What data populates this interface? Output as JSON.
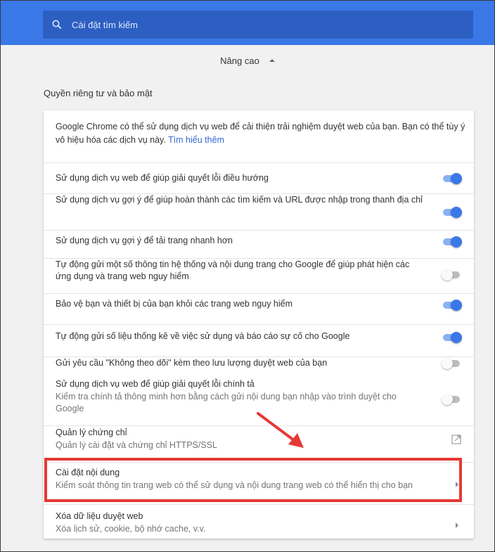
{
  "header": {
    "search_placeholder": "Cài đặt tìm kiếm",
    "accent_color": "#3b78e7"
  },
  "advanced": {
    "label": "Nâng cao"
  },
  "section": {
    "title": "Quyền riêng tư và bảo mật"
  },
  "intro": {
    "text": "Google Chrome có thể sử dụng dịch vụ web để cải thiện trải nghiệm duyệt web của bạn. Bạn có thể tùy ý vô hiệu hóa các dịch vụ này.",
    "link": "Tìm hiểu thêm"
  },
  "settings": [
    {
      "label": "Sử dụng dịch vụ web để giúp giải quyết lỗi điều hướng",
      "enabled": true
    },
    {
      "label": "Sử dụng dịch vụ gợi ý để giúp hoàn thành các tìm kiếm và URL được nhập trong thanh địa chỉ",
      "enabled": true
    },
    {
      "label": "Sử dụng dịch vụ gợi ý để tải trang nhanh hơn",
      "enabled": true
    },
    {
      "label": "Tự động gửi một số thông tin hệ thống và nội dung trang cho Google để giúp phát hiện các ứng dụng và trang web nguy hiểm",
      "enabled": false
    },
    {
      "label": "Bảo vệ bạn và thiết bị của bạn khỏi các trang web nguy hiểm",
      "enabled": true
    },
    {
      "label": "Tự động gửi số liệu thống kê về việc sử dụng và báo cáo sự cố cho Google",
      "enabled": true
    },
    {
      "label": "Gửi yêu cầu \"Không theo dõi\" kèm theo lưu lượng duyệt web của bạn",
      "enabled": false
    },
    {
      "label": "Sử dụng dịch vụ web để giúp giải quyết lỗi chính tả",
      "sub": "Kiểm tra chính tả thông minh hơn bằng cách gửi nội dung bạn nhập vào trình duyệt cho Google",
      "enabled": false
    }
  ],
  "links": [
    {
      "label": "Quản lý chứng chỉ",
      "sub": "Quản lý cài đặt và chứng chỉ HTTPS/SSL",
      "icon": "external-link-icon"
    },
    {
      "label": "Cài đặt nội dung",
      "sub": "Kiểm soát thông tin trang web có thể sử dụng và nội dung trang web có thể hiển thị cho bạn",
      "icon": "chevron-right-icon"
    },
    {
      "label": "Xóa dữ liệu duyệt web",
      "sub": "Xóa lịch sử, cookie, bộ nhớ cache, v.v.",
      "icon": "chevron-right-icon"
    }
  ],
  "annotation": {
    "highlight_color": "#e53935"
  }
}
